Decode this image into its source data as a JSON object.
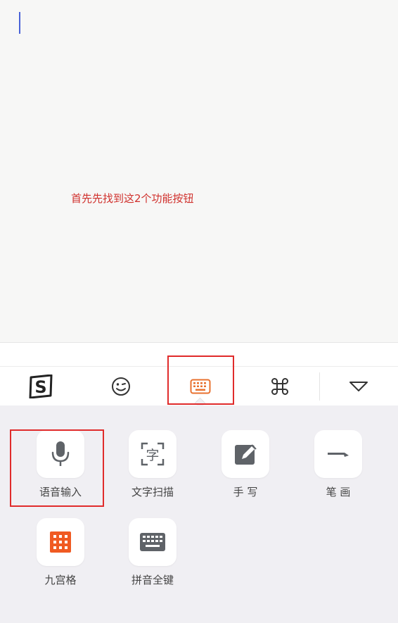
{
  "annotation": {
    "text": "首先先找到这2个功能按钮"
  },
  "toolbar": {
    "items": [
      {
        "name": "sogou-logo",
        "icon": "sogou-s-icon"
      },
      {
        "name": "emoji",
        "icon": "smiley-wink-icon"
      },
      {
        "name": "keyboard",
        "icon": "keyboard-icon",
        "selected": true
      },
      {
        "name": "command",
        "icon": "command-icon"
      },
      {
        "name": "collapse",
        "icon": "triangle-down-icon"
      }
    ],
    "accent_color": "#e8712f"
  },
  "functions": {
    "voice": {
      "label": "语音输入",
      "icon": "microphone-icon"
    },
    "scan": {
      "label": "文字扫描",
      "icon": "text-scan-icon",
      "glyph": "字"
    },
    "handwriting": {
      "label": "手 写",
      "icon": "pen-square-icon"
    },
    "stroke": {
      "label": "笔 画",
      "icon": "stroke-icon"
    },
    "nine_grid": {
      "label": "九宫格",
      "icon": "grid-icon"
    },
    "full_pinyin": {
      "label": "拼音全键",
      "icon": "keyboard-icon"
    }
  },
  "highlight_color": "#e02b2b"
}
